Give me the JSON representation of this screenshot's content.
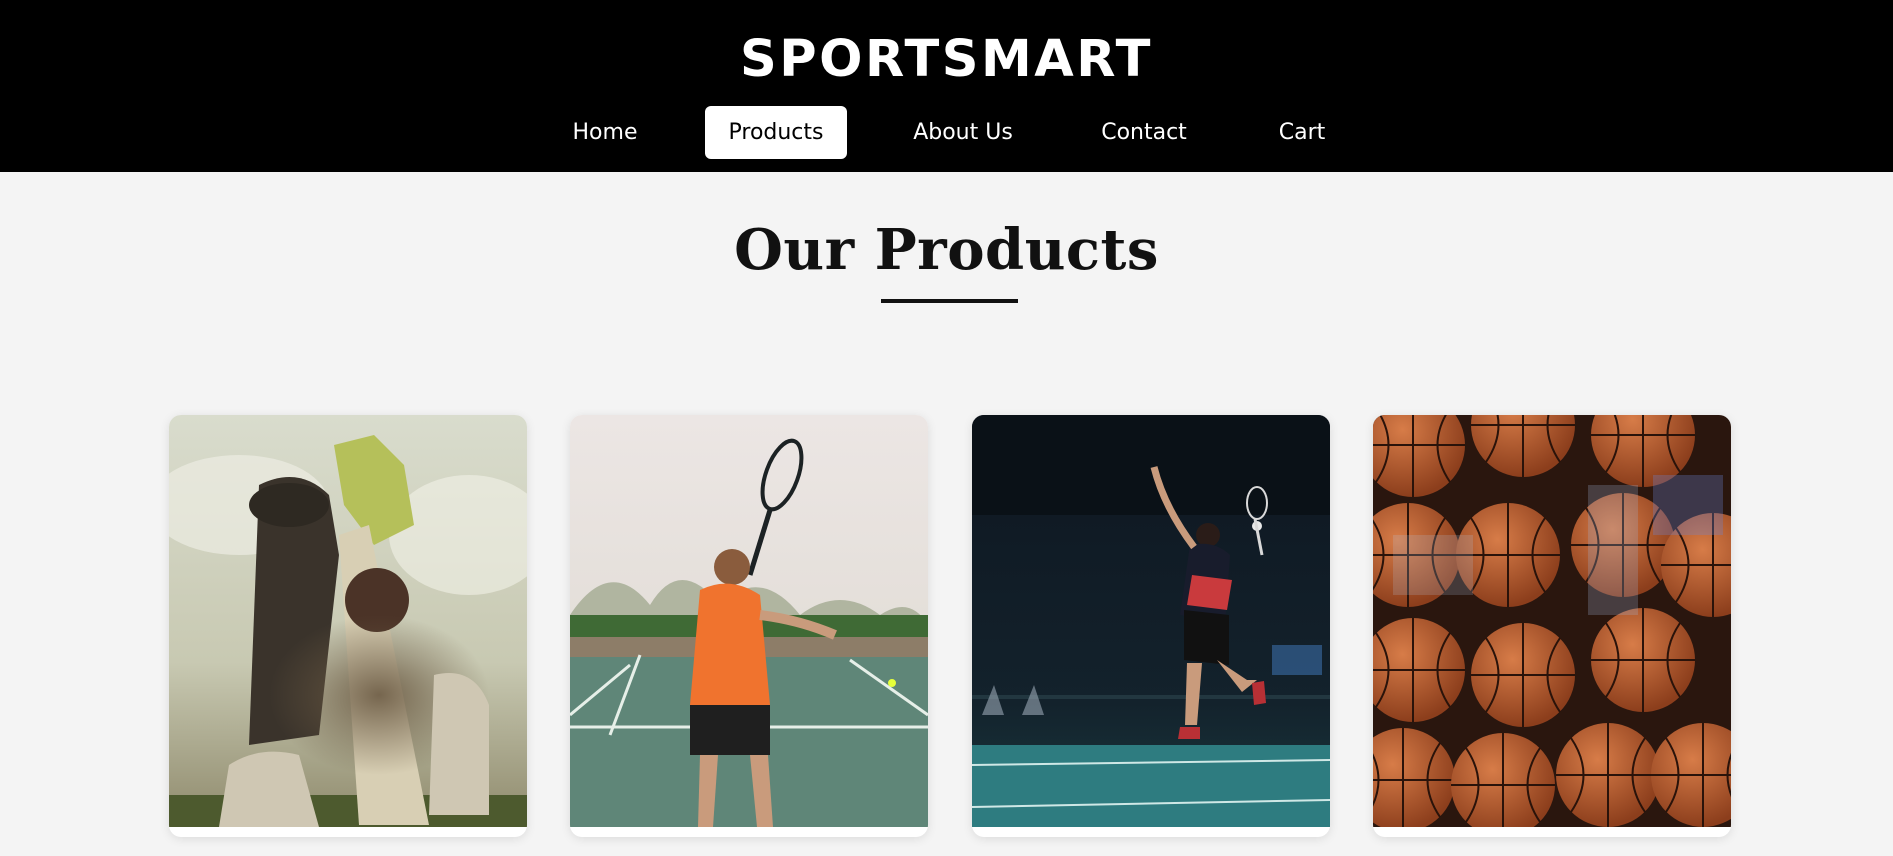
{
  "header": {
    "logo": "SPORTSMART",
    "nav": [
      {
        "label": "Home",
        "active": false
      },
      {
        "label": "Products",
        "active": true
      },
      {
        "label": "About Us",
        "active": false
      },
      {
        "label": "Contact",
        "active": false
      },
      {
        "label": "Cart",
        "active": false
      }
    ]
  },
  "main": {
    "title": "Our Products",
    "products": [
      {
        "image": "cricket-batsman-photo"
      },
      {
        "image": "tennis-player-photo"
      },
      {
        "image": "badminton-player-photo"
      },
      {
        "image": "basketballs-photo"
      }
    ]
  },
  "colors": {
    "header_bg": "#000000",
    "page_bg": "#f4f4f4",
    "active_nav_bg": "#ffffff",
    "title_text": "#111111"
  }
}
